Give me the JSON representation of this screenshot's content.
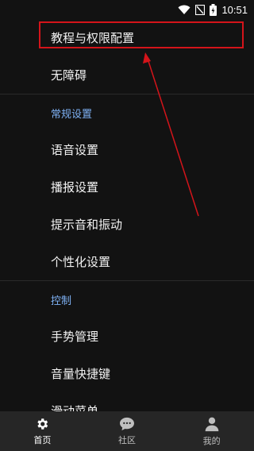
{
  "status_bar": {
    "time": "10:51"
  },
  "menu": {
    "items_top": [
      {
        "label": "教程与权限配置"
      },
      {
        "label": "无障碍"
      }
    ],
    "section_general": {
      "header": "常规设置",
      "items": [
        {
          "label": "语音设置"
        },
        {
          "label": "播报设置"
        },
        {
          "label": "提示音和振动"
        },
        {
          "label": "个性化设置"
        }
      ]
    },
    "section_control": {
      "header": "控制",
      "items": [
        {
          "label": "手势管理"
        },
        {
          "label": "音量快捷键"
        },
        {
          "label": "滑动菜单"
        }
      ]
    }
  },
  "bottom_nav": {
    "tabs": [
      {
        "label": "首页",
        "icon": "gear-icon",
        "active": true
      },
      {
        "label": "社区",
        "icon": "chat-bubble-icon",
        "active": false
      },
      {
        "label": "我的",
        "icon": "person-icon",
        "active": false
      }
    ]
  },
  "colors": {
    "background": "#121212",
    "section_header": "#7fb2f5",
    "highlight_annotation": "#d4141a",
    "bottom_nav_bg": "#262626"
  }
}
